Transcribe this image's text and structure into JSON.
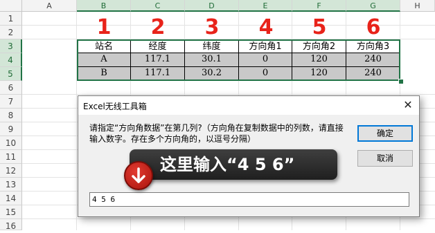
{
  "sheet": {
    "columns": [
      "A",
      "B",
      "C",
      "D",
      "E",
      "F",
      "G",
      "H"
    ],
    "rows": [
      "1",
      "2",
      "3",
      "4",
      "5",
      "6",
      "7",
      "8",
      "9",
      "10",
      "11",
      "12",
      "13",
      "14",
      "15",
      "16"
    ],
    "column_numbers": [
      "1",
      "2",
      "3",
      "4",
      "5",
      "6"
    ],
    "table": {
      "headers": [
        "站名",
        "经度",
        "纬度",
        "方向角1",
        "方向角2",
        "方向角3"
      ],
      "rows": [
        [
          "A",
          "117.1",
          "30.1",
          "0",
          "120",
          "240"
        ],
        [
          "B",
          "117.1",
          "30.2",
          "0",
          "120",
          "240"
        ]
      ]
    }
  },
  "dialog": {
    "title": "Excel无线工具箱",
    "close_symbol": "✕",
    "prompt": "请指定“方向角数据”在第几列?（方向角在复制数据中的列数，请直接输入数字。存在多个方向角的，以逗号分隔）",
    "ok_label": "确定",
    "cancel_label": "取消",
    "input_value": "4 5 6"
  },
  "annotation": {
    "text": "这里输入“4 5 6”"
  },
  "colors": {
    "selection_green": "#217346",
    "annotation_red": "#e8231a",
    "table_fill": "#c9c9c9"
  },
  "icons": {
    "badge": "arrow-down-icon",
    "close": "close-icon"
  }
}
